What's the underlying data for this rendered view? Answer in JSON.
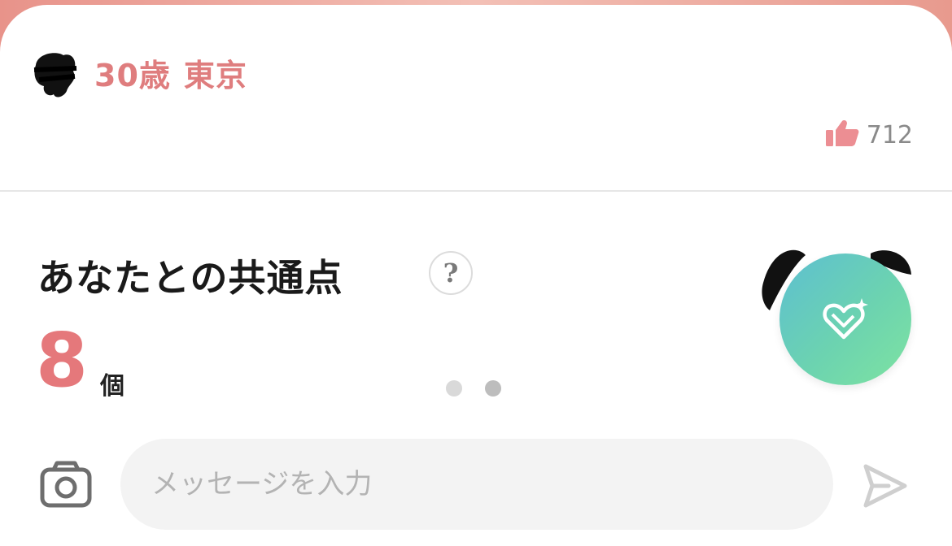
{
  "profile": {
    "age": "30歳",
    "location": "東京",
    "like_count": "712"
  },
  "common_points": {
    "title": "あなたとの共通点",
    "help_label": "?",
    "count": "8",
    "unit": "個",
    "page_total": 2,
    "page_active": 2
  },
  "message_bar": {
    "placeholder": "メッセージを入力"
  },
  "colors": {
    "accent_pink": "#df7d7e",
    "count_pink": "#e5787b",
    "fab_gradient_start": "#5dbfd1",
    "fab_gradient_end": "#7ee3a1"
  },
  "icons": {
    "like": "thumbs-up-icon",
    "help": "question-icon",
    "fab": "heart-diamond-sparkle-icon",
    "camera": "camera-icon",
    "send": "send-icon"
  }
}
